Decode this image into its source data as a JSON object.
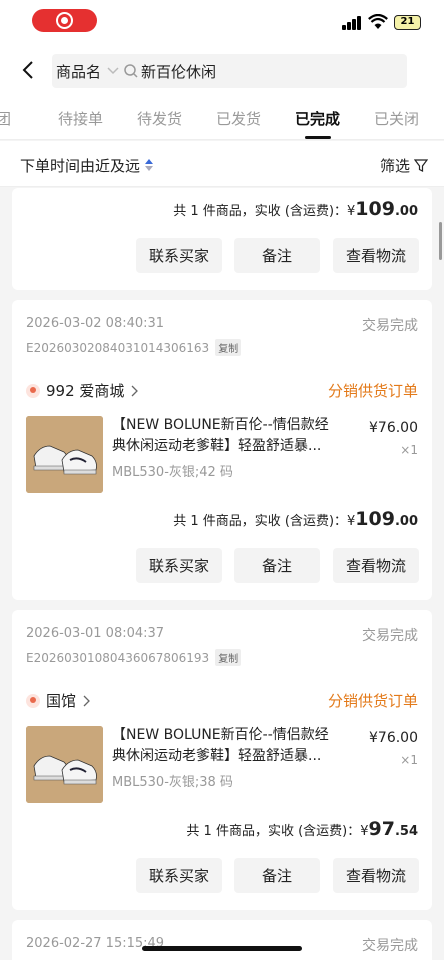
{
  "status_bar": {
    "battery": "21"
  },
  "header": {
    "search_type": "商品名",
    "search_query": "新百伦休闲"
  },
  "tabs": [
    {
      "label": "团"
    },
    {
      "label": "待接单"
    },
    {
      "label": "待发货"
    },
    {
      "label": "已发货"
    },
    {
      "label": "已完成"
    },
    {
      "label": "已关闭"
    }
  ],
  "sort": {
    "label": "下单时间由近及远",
    "filter_label": "筛选"
  },
  "summary_prefix": "共 1 件商品，实收 (含运费)：",
  "yen": "¥",
  "buttons": {
    "contact": "联系买家",
    "note": "备注",
    "logistics": "查看物流"
  },
  "copy_label": "复制",
  "orders": [
    {
      "total_int": "109",
      "total_dec": ".00"
    },
    {
      "date": "2026-03-02 08:40:31",
      "status": "交易完成",
      "order_no": "E20260302084031014306163",
      "shop": "992 爱商城",
      "tag": "分销供货订单",
      "title": "【NEW BOLUNE新百伦--情侣款经典休闲运动老爹鞋】轻盈舒适暴...",
      "spec": "MBL530-灰银;42 码",
      "price": "¥76.00",
      "qty": "×1",
      "total_int": "109",
      "total_dec": ".00"
    },
    {
      "date": "2026-03-01 08:04:37",
      "status": "交易完成",
      "order_no": "E20260301080436067806193",
      "shop": "国馆",
      "tag": "分销供货订单",
      "title": "【NEW BOLUNE新百伦--情侣款经典休闲运动老爹鞋】轻盈舒适暴...",
      "spec": "MBL530-灰银;38 码",
      "price": "¥76.00",
      "qty": "×1",
      "total_int": "97",
      "total_dec": ".54"
    },
    {
      "date": "2026-02-27 15:15:49",
      "status": "交易完成"
    }
  ],
  "colors": {
    "accent_orange": "#e37a1a",
    "record_red": "#e53030"
  }
}
